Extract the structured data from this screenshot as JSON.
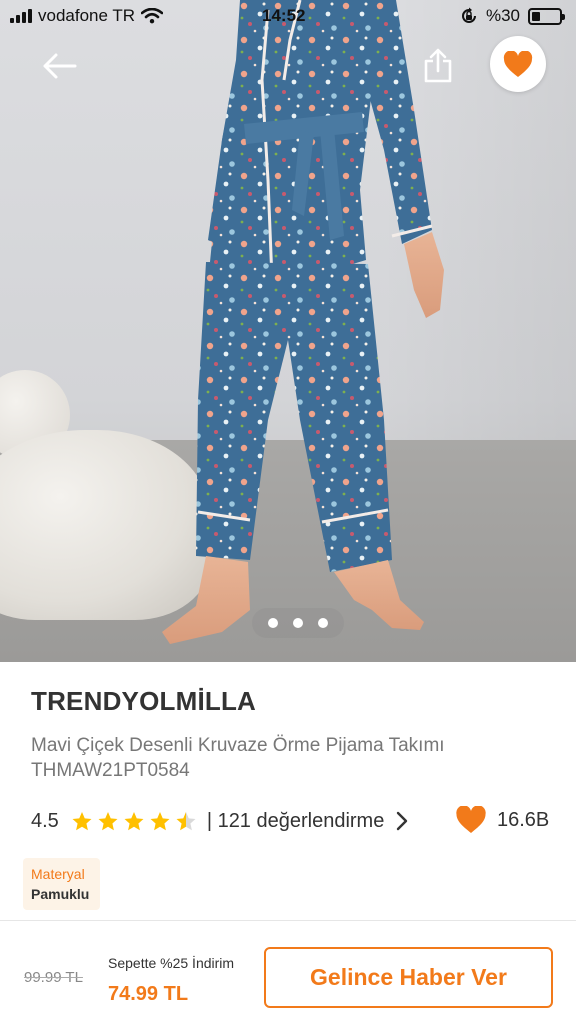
{
  "status_bar": {
    "carrier": "vodafone TR",
    "time": "14:52",
    "battery": "%30",
    "battery_level": 0.3
  },
  "icons": {
    "back": "arrow-left-icon",
    "share": "share-icon",
    "favorite": "heart-icon",
    "star": "star-icon",
    "chevron": "chevron-right-icon"
  },
  "gallery": {
    "image_count": 3,
    "active_index": 0
  },
  "product": {
    "brand": "TRENDYOLMİLLA",
    "name": "Mavi Çiçek Desenli Kruvaze Örme Pijama Takımı THMAW21PT0584",
    "rating": "4.5",
    "rating_value": 4.5,
    "reviews": "| 121 değerlendirme",
    "favorite_count": "16.6B"
  },
  "attributes": {
    "material_label": "Materyal",
    "material_value": "Pamuklu"
  },
  "purchase": {
    "old_price": "99.99 TL",
    "basket_discount": "Sepette %25 İndirim",
    "new_price": "74.99 TL",
    "notify_button": "Gelince Haber Ver"
  },
  "colors": {
    "accent": "#f27a1a",
    "star": "#ffc000",
    "pajama": "#3f6f98"
  }
}
